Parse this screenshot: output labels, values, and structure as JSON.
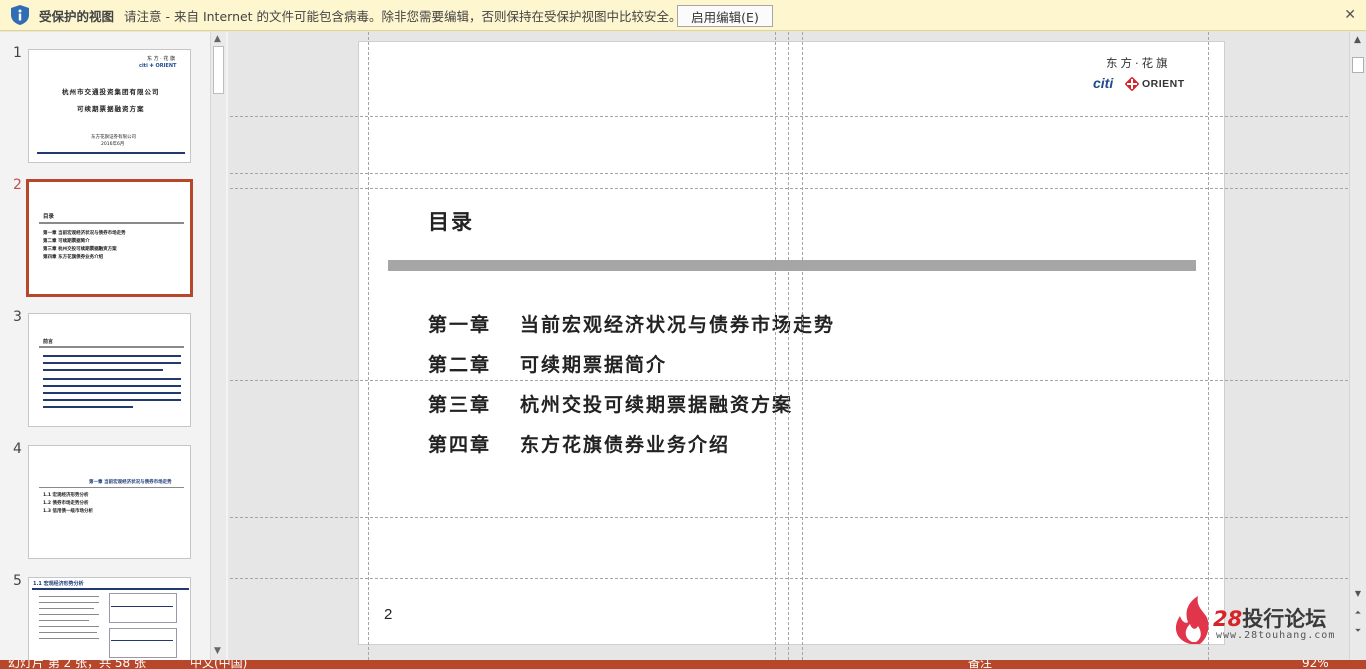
{
  "protected_view": {
    "title": "受保护的视图",
    "message": "请注意 - 来自 Internet 的文件可能包含病毒。除非您需要编辑，否则保持在受保护视图中比较安全。",
    "enable_editing": "启用编辑(E)",
    "close": "✕"
  },
  "thumbnails": {
    "numbers": [
      "1",
      "2",
      "3",
      "4",
      "5"
    ],
    "thumb1": {
      "logo": "东 方 · 花 旗",
      "logo_brand": "citi ✚ ORIENT",
      "line1": "杭州市交通投资集团有限公司",
      "line2": "可续期票据融资方案",
      "line3": "东方花旗证券有限公司",
      "line4": "2016年6月"
    },
    "thumb2": {
      "title": "目录",
      "items": [
        "第一章  当前宏观经济状况与债券市场走势",
        "第二章  可续期票据简介",
        "第三章  杭州交投可续期票据融资方案",
        "第四章  东方花旗债券业务介绍"
      ]
    },
    "thumb3": {
      "title": "前言"
    },
    "thumb4": {
      "heading": "第一章  当前宏观经济状况与债券市场走势",
      "items": [
        "1.1  宏观经济形势分析",
        "1.2  债券市场走势分析",
        "1.3  信用债一级市场分析"
      ]
    },
    "thumb5": {
      "heading": "1.1  宏观经济形势分析"
    }
  },
  "slide": {
    "logo_cn": "东方·花旗",
    "logo_citi": "citi",
    "logo_orient": "ORIENT",
    "title": "目录",
    "toc": [
      {
        "chapter": "第一章",
        "text": "当前宏观经济状况与债券市场走势"
      },
      {
        "chapter": "第二章",
        "text": "可续期票据简介"
      },
      {
        "chapter": "第三章",
        "text": "杭州交投可续期票据融资方案"
      },
      {
        "chapter": "第四章",
        "text": "东方花旗债券业务介绍"
      }
    ],
    "page_number": "2"
  },
  "watermark": {
    "num": "28",
    "name": "投行论坛",
    "url": "www.28touhang.com"
  },
  "status": {
    "slide_info": "幻灯片 第 2 张，共 58 张",
    "language": "中文(中国)",
    "notes": "备注",
    "zoom": "92%"
  },
  "colors": {
    "accent": "#b7472a",
    "protect_bg": "#fdf6cf",
    "citi_blue": "#1f4b8e",
    "orient_red": "#d8232a"
  }
}
